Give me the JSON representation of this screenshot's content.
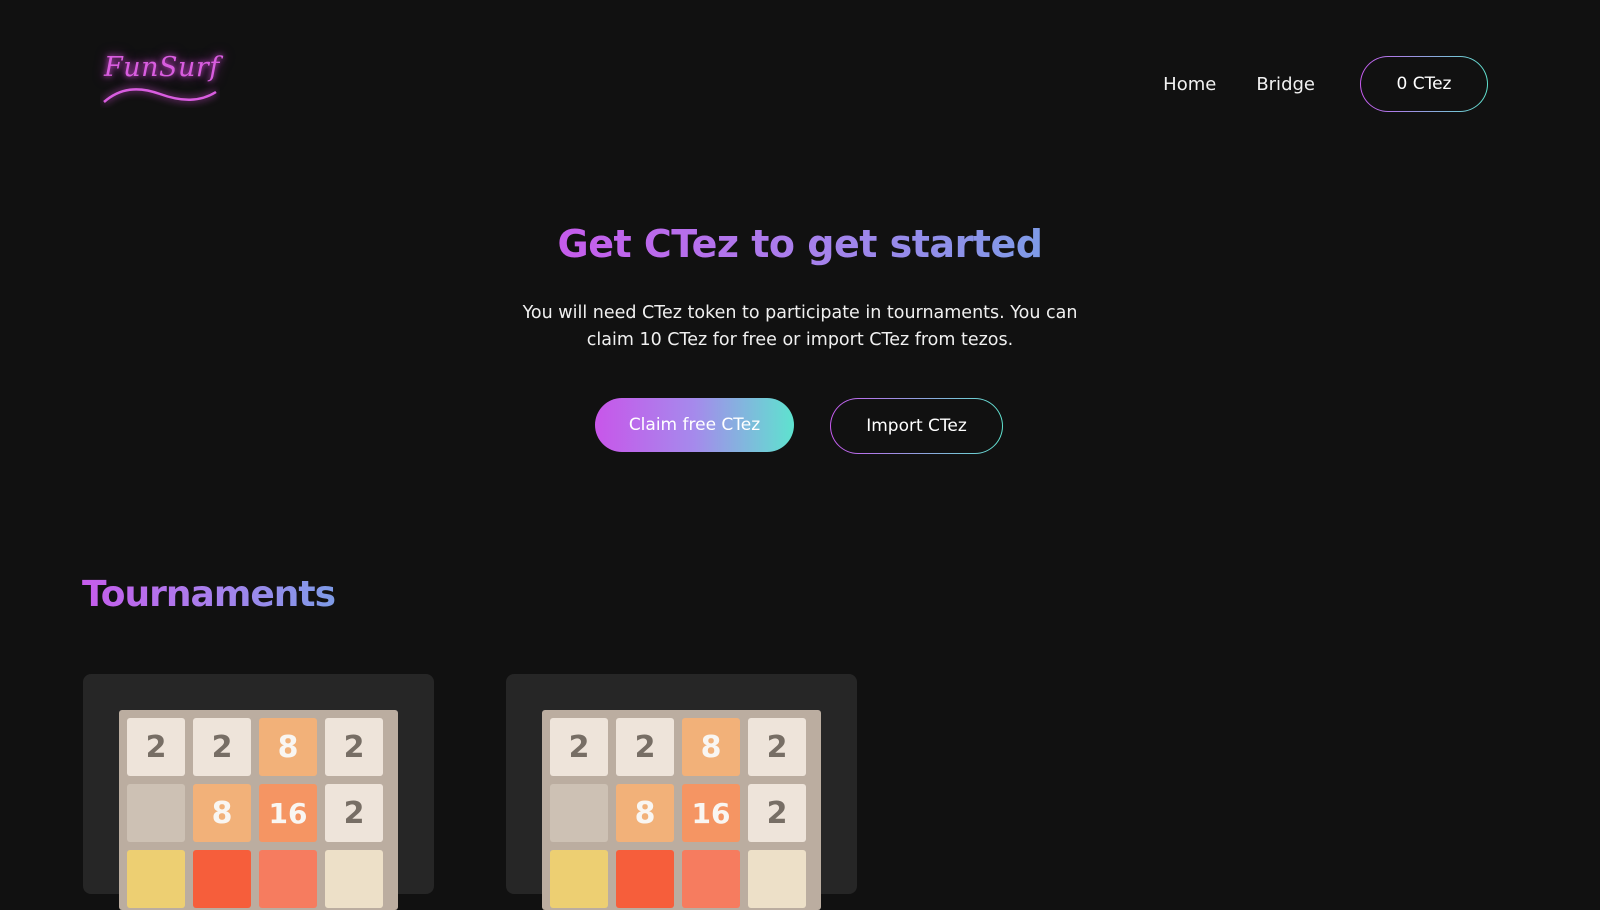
{
  "brand": {
    "logo_text": "FunSurf",
    "color": "#d95de0"
  },
  "nav": {
    "links": [
      {
        "label": "Home"
      },
      {
        "label": "Bridge"
      }
    ],
    "balance_label": "0 CTez"
  },
  "hero": {
    "title": "Get CTez to get started",
    "subtitle": "You will need CTez token to participate in tournaments. You can claim 10 CTez for free or import CTez from tezos.",
    "claim_label": "Claim free CTez",
    "import_label": "Import CTez"
  },
  "tournaments": {
    "title": "Tournaments",
    "cards": [
      {
        "board_rows": [
          [
            "2",
            "2",
            "8",
            "2"
          ],
          [
            "",
            "8",
            "16",
            "2"
          ],
          [
            "",
            "",
            "",
            ""
          ]
        ]
      },
      {
        "board_rows": [
          [
            "2",
            "2",
            "8",
            "2"
          ],
          [
            "",
            "8",
            "16",
            "2"
          ],
          [
            "",
            "",
            "",
            ""
          ]
        ]
      }
    ]
  },
  "colors": {
    "background": "#111111",
    "card": "#262626",
    "gradient_start": "#c65cec",
    "gradient_end": "#5ee3cf"
  }
}
